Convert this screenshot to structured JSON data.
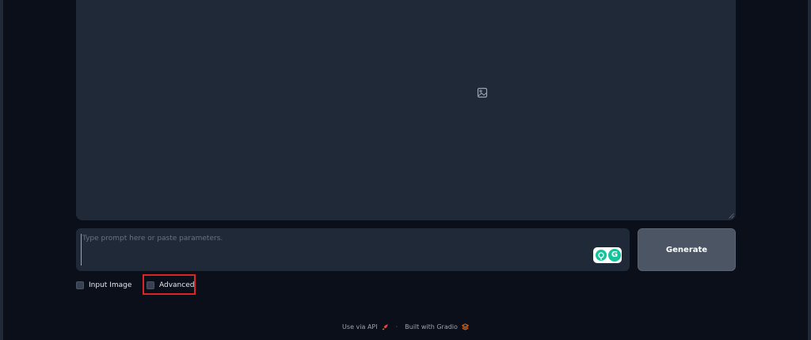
{
  "prompt": {
    "placeholder": "Type prompt here or paste parameters.",
    "value": ""
  },
  "generate_button": {
    "label": "Generate"
  },
  "options": [
    {
      "label": "Input Image",
      "checked": false
    },
    {
      "label": "Advanced",
      "checked": false
    }
  ],
  "footer": {
    "api_link": "Use via API",
    "separator": "·",
    "built_with": "Built with Gradio"
  },
  "icons": {
    "image_placeholder": "image-icon",
    "api": "rocket-icon",
    "gradio": "gradio-logo-icon",
    "grammarly": "grammarly-icon"
  },
  "colors": {
    "background": "#0b0f19",
    "panel": "#1f2937",
    "button": "#4b5563",
    "highlight": "#dc2626",
    "grammarly": "#15c39a",
    "gradio": "#f97316"
  }
}
